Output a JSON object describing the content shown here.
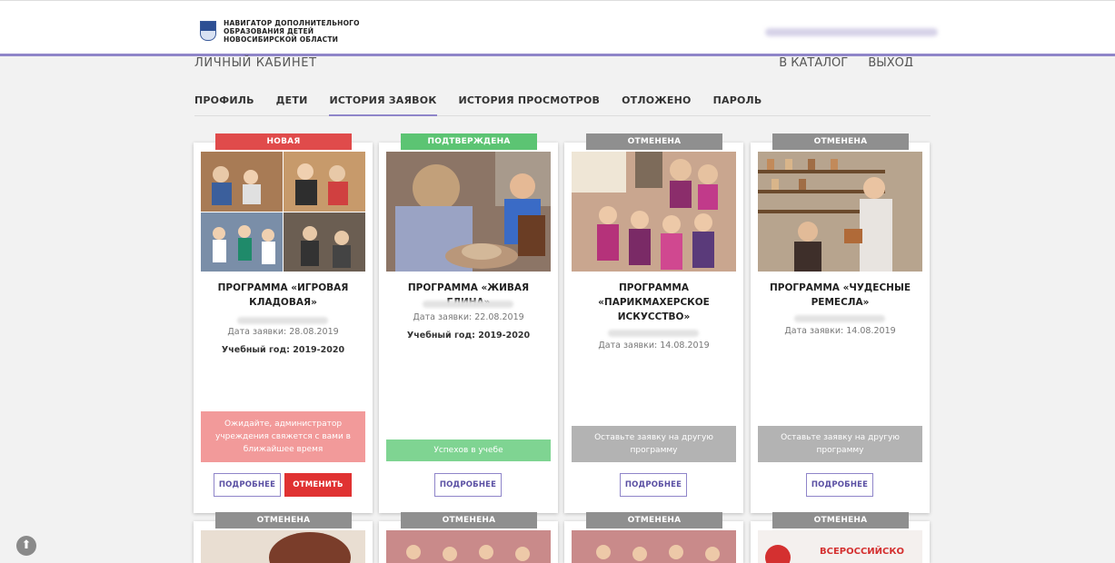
{
  "header": {
    "brand_line1": "НАВИГАТОР ДОПОЛНИТЕЛЬНОГО",
    "brand_line2": "ОБРАЗОВАНИЯ ДЕТЕЙ",
    "brand_line3": "НОВОСИБИРСКОЙ ОБЛАСТИ",
    "cabinet_title": "ЛИЧНЫЙ КАБИНЕТ",
    "catalog_link": "В КАТАЛОГ",
    "logout_link": "ВЫХОД"
  },
  "tabs": [
    {
      "label": "ПРОФИЛЬ"
    },
    {
      "label": "ДЕТИ"
    },
    {
      "label": "ИСТОРИЯ ЗАЯВОК"
    },
    {
      "label": "ИСТОРИЯ ПРОСМОТРОВ"
    },
    {
      "label": "ОТЛОЖЕНО"
    },
    {
      "label": "ПАРОЛЬ"
    }
  ],
  "cards": [
    {
      "badge": "НОВАЯ",
      "title_line1": "ПРОГРАММА «ИГРОВАЯ",
      "title_line2": "КЛАДОВАЯ»",
      "date": "Дата заявки: 28.08.2019",
      "year": "Учебный год: 2019-2020",
      "status_line1": "Ожидайте, администратор",
      "status_line2": "учреждения свяжется с вами в",
      "status_line3": "ближайшее время",
      "more": "ПОДРОБНЕЕ",
      "cancel": "ОТМЕНИТЬ"
    },
    {
      "badge": "ПОДТВЕРЖДЕНА",
      "title_line1": "ПРОГРАММА «ЖИВАЯ ГЛИНА»",
      "date": "Дата заявки: 22.08.2019",
      "year": "Учебный год: 2019-2020",
      "status_line1": "Успехов в учебе",
      "more": "ПОДРОБНЕЕ"
    },
    {
      "badge": "ОТМЕНЕНА",
      "title_line1": "ПРОГРАММА",
      "title_line2": "«ПАРИКМАХЕРСКОЕ",
      "title_line3": "ИСКУССТВО»",
      "date": "Дата заявки: 14.08.2019",
      "status_line1": "Оставьте заявку на другую",
      "status_line2": "программу",
      "more": "ПОДРОБНЕЕ"
    },
    {
      "badge": "ОТМЕНЕНА",
      "title_line1": "ПРОГРАММА «ЧУДЕСНЫЕ",
      "title_line2": "РЕМЕСЛА»",
      "date": "Дата заявки: 14.08.2019",
      "status_line1": "Оставьте заявку на другую",
      "status_line2": "программу",
      "more": "ПОДРОБНЕЕ"
    }
  ],
  "next_row": [
    {
      "badge": "ОТМЕНЕНА"
    },
    {
      "badge": "ОТМЕНЕНА"
    },
    {
      "badge": "ОТМЕНЕНА"
    },
    {
      "badge": "ОТМЕНЕНА",
      "poster_text": "ВСЕРОССИЙСКО"
    }
  ],
  "scroll_up": "⬆"
}
